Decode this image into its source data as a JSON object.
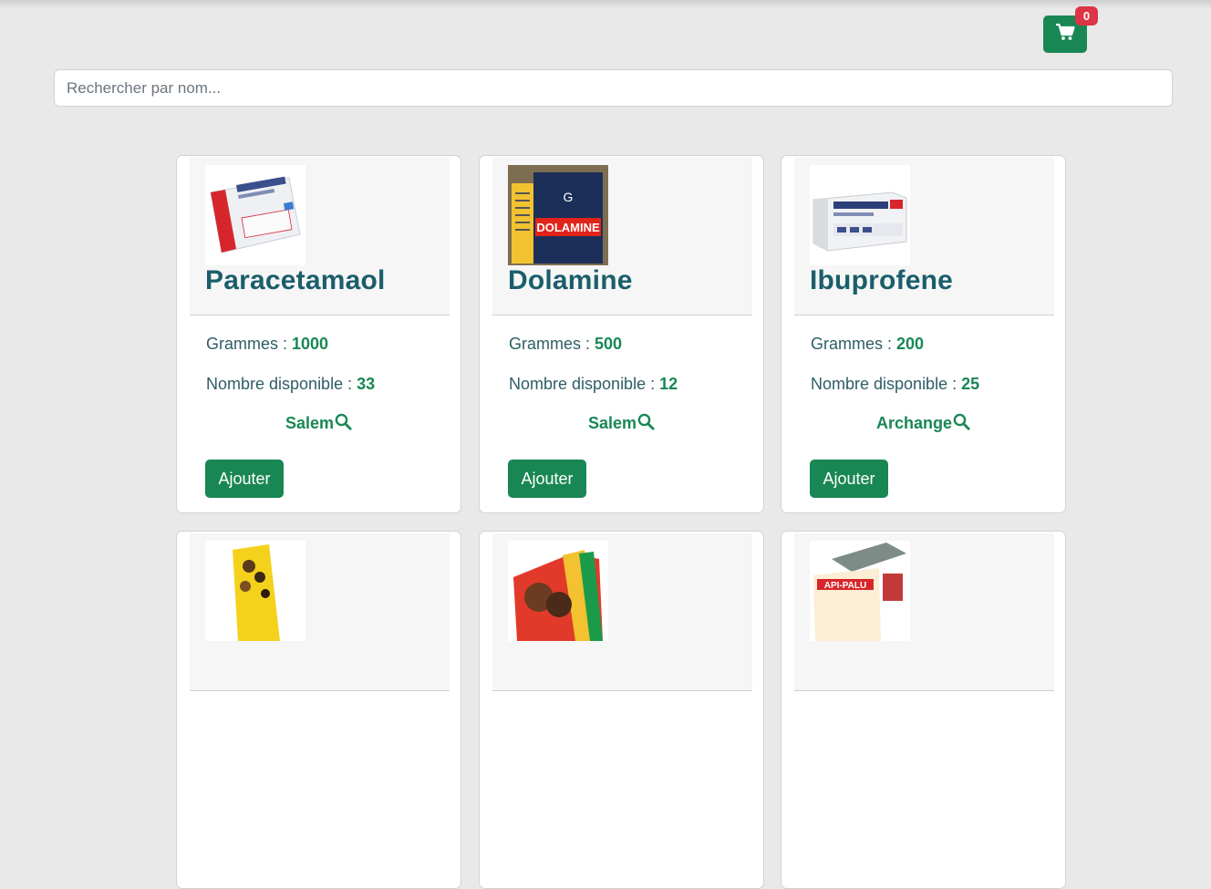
{
  "header": {
    "cart_icon": "shopping-cart-icon",
    "cart_count": "0",
    "accent_color": "#198754",
    "badge_color": "#dc3545"
  },
  "search": {
    "placeholder": "Rechercher par nom...",
    "value": ""
  },
  "labels": {
    "grams": "Grammes : ",
    "available": "Nombre disponible : ",
    "add": "Ajouter",
    "owner_icon": "search-icon"
  },
  "products": [
    {
      "name": "Paracetamaol",
      "grams": "1000",
      "available": "33",
      "owner": "Salem",
      "image": "paracetamol-box"
    },
    {
      "name": "Dolamine",
      "grams": "500",
      "available": "12",
      "owner": "Salem",
      "image": "dolamine-box"
    },
    {
      "name": "Ibuprofene",
      "grams": "200",
      "available": "25",
      "owner": "Archange",
      "image": "ibuprofene-box"
    }
  ],
  "partial_products": [
    {
      "image": "yellow-product-box"
    },
    {
      "image": "colorful-product-box"
    },
    {
      "image": "api-palu-box"
    }
  ]
}
